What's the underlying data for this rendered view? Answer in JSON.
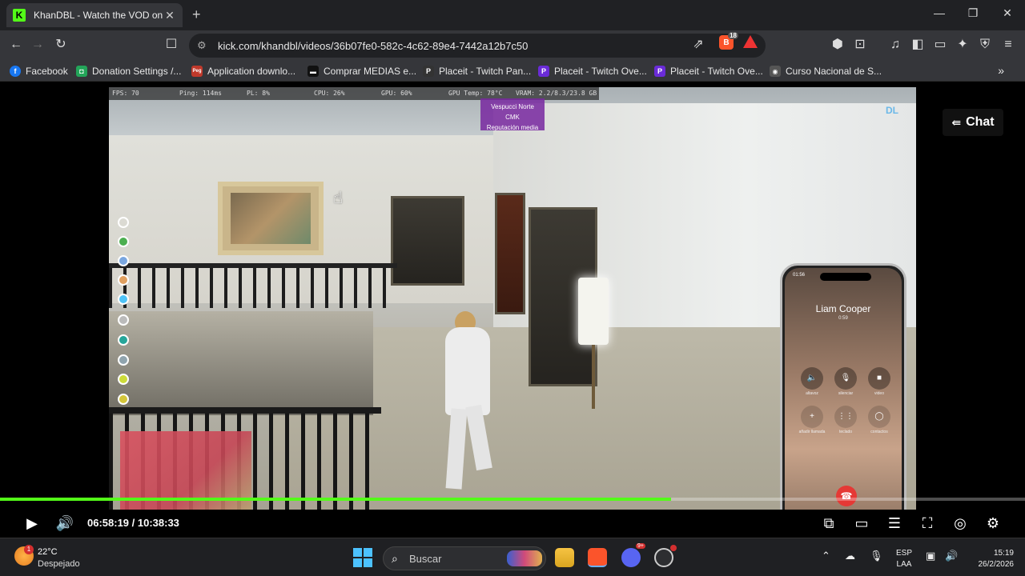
{
  "browser": {
    "tab_title": "KhanDBL - Watch the VOD on Ki",
    "tab_favicon": "K",
    "url": "kick.com/khandbl/videos/36b07fe0-582c-4c62-89e4-7442a12b7c50",
    "brave_shield_count": "18"
  },
  "bookmarks": [
    {
      "label": "Facebook",
      "icon": "facebook-icon",
      "color": "#1877f2",
      "glyph": "f"
    },
    {
      "label": "Donation Settings /...",
      "icon": "donation-icon",
      "color": "#23a559",
      "glyph": "◘"
    },
    {
      "label": "Application downlo...",
      "icon": "app-download-icon",
      "color": "#c0392b",
      "glyph": "Peg"
    },
    {
      "label": "Comprar MEDIAS e...",
      "icon": "medias-icon",
      "color": "#111",
      "glyph": "▬"
    },
    {
      "label": "Placeit - Twitch Pan...",
      "icon": "placeit-icon",
      "color": "#333",
      "glyph": "P"
    },
    {
      "label": "Placeit - Twitch Ove...",
      "icon": "placeit-purple-icon",
      "color": "#6a2bd8",
      "glyph": "P"
    },
    {
      "label": "Placeit - Twitch Ove...",
      "icon": "placeit-purple-icon",
      "color": "#6a2bd8",
      "glyph": "P"
    },
    {
      "label": "Curso Nacional de S...",
      "icon": "curso-icon",
      "color": "#555",
      "glyph": "◉"
    }
  ],
  "game": {
    "hud": {
      "fps": "FPS: 70",
      "ping": "Ping: 114ms",
      "pl": "PL: 8%",
      "cpu": "CPU: 26%",
      "gpu": "GPU: 60%",
      "gpu_temp": "GPU Temp: 78°C",
      "vram": "VRAM: 2.2/8.3/23.8 GB"
    },
    "nametag": {
      "line1": "Vespucci Norte",
      "line2": "CMK",
      "line3": "Reputación media"
    },
    "logo": "DL",
    "phone": {
      "status_time": "01:56",
      "caller": "Liam Cooper",
      "call_time": "0:59",
      "buttons": [
        {
          "icon": "speaker-icon",
          "glyph": "🔈",
          "label": "altavoz"
        },
        {
          "icon": "mic-icon",
          "glyph": "🎙",
          "label": "silenciar"
        },
        {
          "icon": "video-icon",
          "glyph": "■",
          "label": "video"
        },
        {
          "icon": "add-call-icon",
          "glyph": "+",
          "label": "añadir llamada"
        },
        {
          "icon": "keypad-icon",
          "glyph": "⋮⋮",
          "label": "teclado"
        },
        {
          "icon": "contacts-icon",
          "glyph": "◯",
          "label": "contactos"
        }
      ]
    }
  },
  "chat_button": "Chat",
  "player": {
    "progress": 0.655,
    "timecode": "06:58:19 / 10:38:33",
    "accent": "#53fc18"
  },
  "taskbar": {
    "weather_temp": "22°C",
    "weather_cond": "Despejado",
    "weather_badge": "1",
    "search_placeholder": "Buscar",
    "discord_badge": "9+",
    "lang1": "ESP",
    "lang2": "LAA",
    "time": "15:19",
    "date": "26/2/2026"
  }
}
